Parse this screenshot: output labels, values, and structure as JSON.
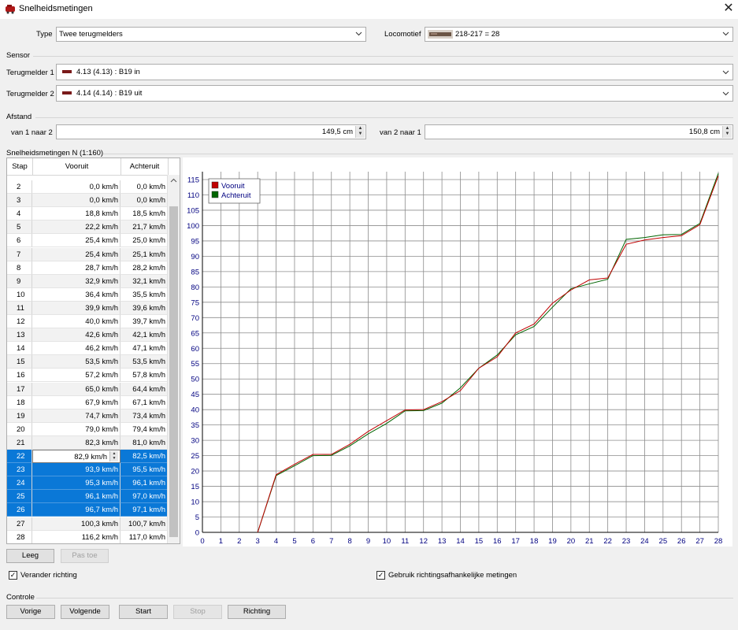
{
  "window": {
    "title": "Snelheidsmetingen",
    "close": "✕"
  },
  "type": {
    "label": "Type",
    "value": "Twee terugmelders"
  },
  "locomotive": {
    "label": "Locomotief",
    "value": "218-217 = 28"
  },
  "sensor": {
    "section": "Sensor",
    "fb1_label": "Terugmelder 1",
    "fb1_value": "4.13 (4.13) : B19 in",
    "fb2_label": "Terugmelder 2",
    "fb2_value": "4.14 (4.14) : B19 uit"
  },
  "distance": {
    "section": "Afstand",
    "a_label": "van 1 naar 2",
    "a_value": "149,5 cm",
    "b_label": "van 2 naar 1",
    "b_value": "150,8 cm"
  },
  "measurements": {
    "section": "Snelheidsmetingen N (1:160)",
    "columns": [
      "Stap",
      "Vooruit",
      "Achteruit"
    ],
    "rows": [
      [
        "2",
        "0,0 km/h",
        "0,0 km/h"
      ],
      [
        "3",
        "0,0 km/h",
        "0,0 km/h"
      ],
      [
        "4",
        "18,8 km/h",
        "18,5 km/h"
      ],
      [
        "5",
        "22,2 km/h",
        "21,7 km/h"
      ],
      [
        "6",
        "25,4 km/h",
        "25,0 km/h"
      ],
      [
        "7",
        "25,4 km/h",
        "25,1 km/h"
      ],
      [
        "8",
        "28,7 km/h",
        "28,2 km/h"
      ],
      [
        "9",
        "32,9 km/h",
        "32,1 km/h"
      ],
      [
        "10",
        "36,4 km/h",
        "35,5 km/h"
      ],
      [
        "11",
        "39,9 km/h",
        "39,6 km/h"
      ],
      [
        "12",
        "40,0 km/h",
        "39,7 km/h"
      ],
      [
        "13",
        "42,6 km/h",
        "42,1 km/h"
      ],
      [
        "14",
        "46,2 km/h",
        "47,1 km/h"
      ],
      [
        "15",
        "53,5 km/h",
        "53,5 km/h"
      ],
      [
        "16",
        "57,2 km/h",
        "57,8 km/h"
      ],
      [
        "17",
        "65,0 km/h",
        "64,4 km/h"
      ],
      [
        "18",
        "67,9 km/h",
        "67,1 km/h"
      ],
      [
        "19",
        "74,7 km/h",
        "73,4 km/h"
      ],
      [
        "20",
        "79,0 km/h",
        "79,4 km/h"
      ],
      [
        "21",
        "82,3 km/h",
        "81,0 km/h"
      ],
      [
        "22",
        "82,9 km/h",
        "82,5 km/h"
      ],
      [
        "23",
        "93,9 km/h",
        "95,5 km/h"
      ],
      [
        "24",
        "95,3 km/h",
        "96,1 km/h"
      ],
      [
        "25",
        "96,1 km/h",
        "97,0 km/h"
      ],
      [
        "26",
        "96,7 km/h",
        "97,1 km/h"
      ],
      [
        "27",
        "100,3 km/h",
        "100,7 km/h"
      ],
      [
        "28",
        "116,2 km/h",
        "117,0 km/h"
      ]
    ],
    "selected_steps": [
      "22",
      "23",
      "24",
      "25",
      "26"
    ],
    "editing_step": "22"
  },
  "buttons": {
    "clear": "Leeg",
    "apply": "Pas toe",
    "prev": "Vorige",
    "next": "Volgende",
    "start": "Start",
    "stop": "Stop",
    "direction": "Richting"
  },
  "options": {
    "change_direction": "Verander richting",
    "use_directional": "Gebruik richtingsafhankelijke metingen"
  },
  "control": {
    "section": "Controle"
  },
  "colors": {
    "forward": "#c00000",
    "reverse": "#006400",
    "selection": "#0a78d7",
    "axis_text": "#000080"
  },
  "chart_data": {
    "type": "line",
    "x": [
      0,
      1,
      2,
      3,
      4,
      5,
      6,
      7,
      8,
      9,
      10,
      11,
      12,
      13,
      14,
      15,
      16,
      17,
      18,
      19,
      20,
      21,
      22,
      23,
      24,
      25,
      26,
      27,
      28
    ],
    "series": [
      {
        "name": "Vooruit",
        "color": "#c00000",
        "values": [
          0,
          0,
          0,
          0,
          18.8,
          22.2,
          25.4,
          25.4,
          28.7,
          32.9,
          36.4,
          39.9,
          40.0,
          42.6,
          46.2,
          53.5,
          57.2,
          65.0,
          67.9,
          74.7,
          79.0,
          82.3,
          82.9,
          93.9,
          95.3,
          96.1,
          96.7,
          100.3,
          116.2
        ]
      },
      {
        "name": "Achteruit",
        "color": "#006400",
        "values": [
          0,
          0,
          0,
          0,
          18.5,
          21.7,
          25.0,
          25.1,
          28.2,
          32.1,
          35.5,
          39.6,
          39.7,
          42.1,
          47.1,
          53.5,
          57.8,
          64.4,
          67.1,
          73.4,
          79.4,
          81.0,
          82.5,
          95.5,
          96.1,
          97.0,
          97.1,
          100.7,
          117.0
        ]
      }
    ],
    "xlim": [
      0,
      28
    ],
    "ylim": [
      0,
      115
    ],
    "yticks": [
      0,
      5,
      10,
      15,
      20,
      25,
      30,
      35,
      40,
      45,
      50,
      55,
      60,
      65,
      70,
      75,
      80,
      85,
      90,
      95,
      100,
      105,
      110,
      115
    ],
    "grid": true,
    "legend": "top-left"
  }
}
